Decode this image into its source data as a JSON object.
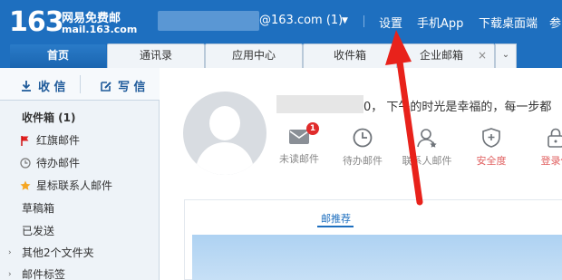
{
  "brand": {
    "number": "163",
    "title": "网易免费邮",
    "domain": "mail.163.com"
  },
  "header": {
    "account_suffix": "@163.com (1)",
    "links": [
      "设置",
      "手机App",
      "下载桌面端",
      "参"
    ]
  },
  "tabs": [
    {
      "label": "首页",
      "active": true
    },
    {
      "label": "通讯录",
      "active": false
    },
    {
      "label": "应用中心",
      "active": false
    },
    {
      "label": "收件箱",
      "active": false
    },
    {
      "label": "企业邮箱",
      "active": false,
      "closable": true
    }
  ],
  "tab_close_glyph": "×",
  "tab_more_glyph": "⌄",
  "sidebar": {
    "receive_label": "收 信",
    "compose_label": "写 信",
    "items": [
      {
        "label": "收件箱 (1)",
        "icon": "none",
        "bold": true
      },
      {
        "label": "红旗邮件",
        "icon": "red-flag-icon"
      },
      {
        "label": "待办邮件",
        "icon": "clock-icon"
      },
      {
        "label": "星标联系人邮件",
        "icon": "star-icon"
      },
      {
        "label": "草稿箱",
        "icon": "none"
      },
      {
        "label": "已发送",
        "icon": "none"
      },
      {
        "label": "其他2个文件夹",
        "icon": "expand-arrow-icon"
      },
      {
        "label": "邮件标签",
        "icon": "expand-arrow-icon"
      }
    ]
  },
  "main": {
    "greeting": "0， 下午的时光是幸福的，每一步都",
    "quick_items": [
      {
        "label": "未读邮件",
        "icon": "mail-icon",
        "badge": "1",
        "color": "#888888"
      },
      {
        "label": "待办邮件",
        "icon": "clock-icon",
        "color": "#888888"
      },
      {
        "label": "联系人邮件",
        "icon": "contact-icon",
        "color": "#888888"
      },
      {
        "label": "安全度",
        "icon": "shield-icon",
        "color": "#e06060"
      },
      {
        "label": "登录保",
        "icon": "lock-icon",
        "color": "#e06060"
      }
    ],
    "panel_tab": "邮推荐"
  },
  "colors": {
    "header_blue": "#1e6fbf",
    "annotation_red": "#e8221b"
  }
}
